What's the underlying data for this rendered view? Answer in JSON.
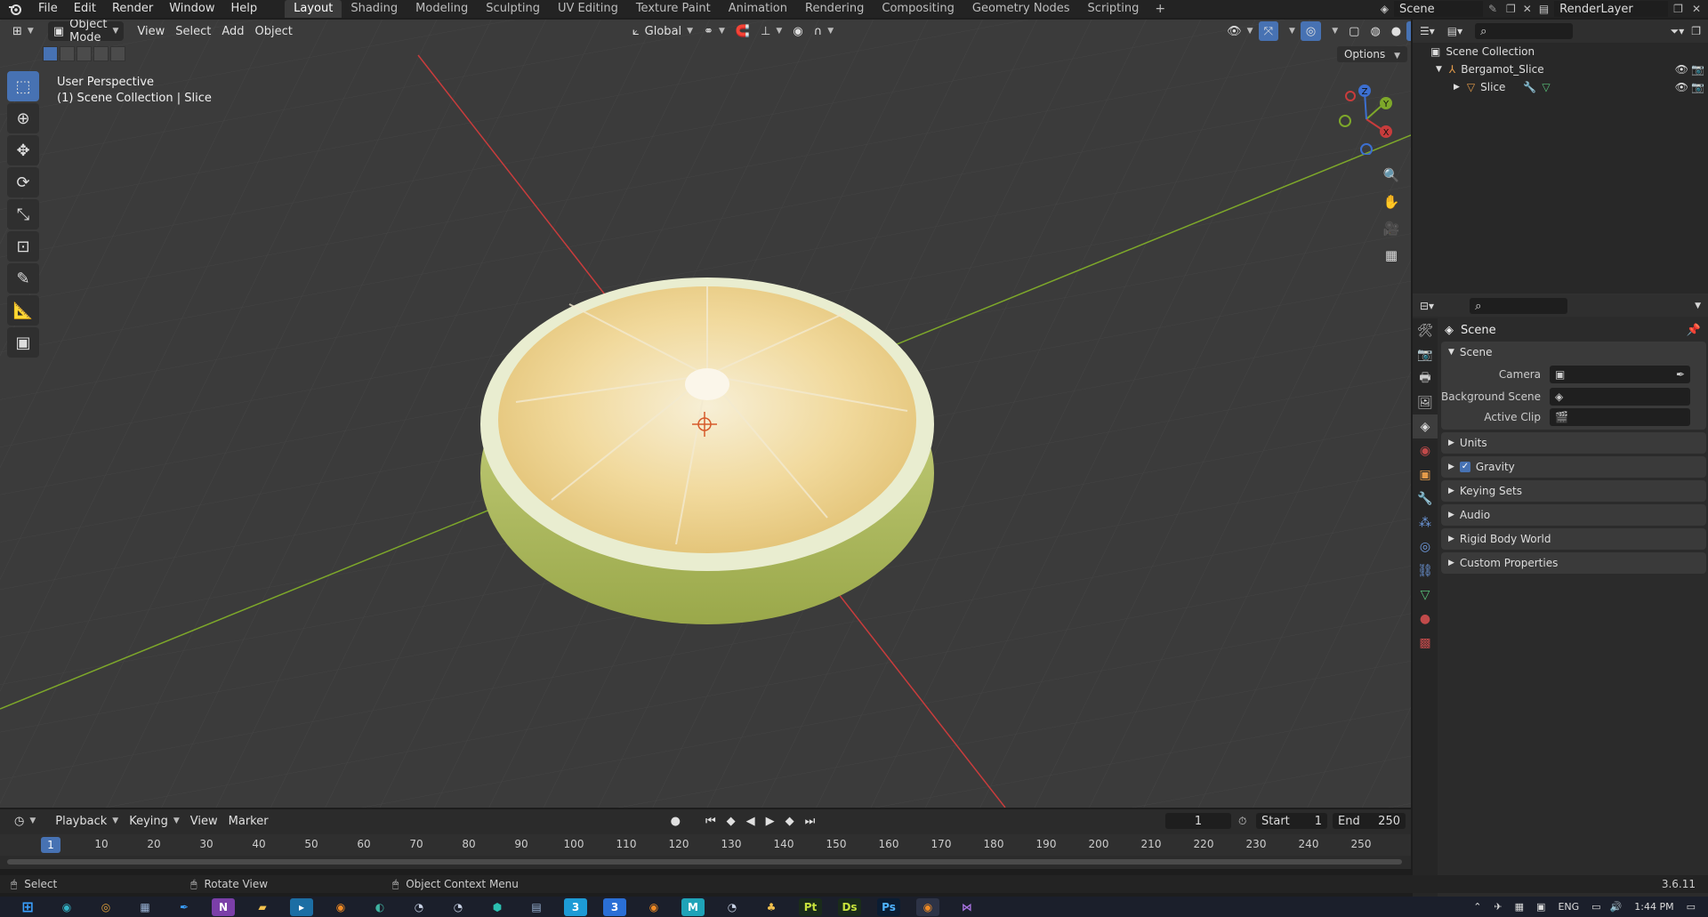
{
  "app": {
    "logo": "blender-logo-icon"
  },
  "menubar": {
    "items": [
      "File",
      "Edit",
      "Render",
      "Window",
      "Help"
    ]
  },
  "workspaces": {
    "tabs": [
      "Layout",
      "Shading",
      "Modeling",
      "Sculpting",
      "UV Editing",
      "Texture Paint",
      "Animation",
      "Rendering",
      "Compositing",
      "Geometry Nodes",
      "Scripting"
    ],
    "active": "Layout",
    "add": "+"
  },
  "topright": {
    "scene": "Scene",
    "view_layer": "RenderLayer"
  },
  "viewport_header": {
    "mode": "Object Mode",
    "menus": [
      "View",
      "Select",
      "Add",
      "Object"
    ],
    "transform_orientation": "Global"
  },
  "viewport": {
    "perspective": "User Perspective",
    "collection": "(1) Scene Collection | Slice",
    "options": "Options",
    "gizmo": {
      "x": "X",
      "y": "Y",
      "z": "Z"
    }
  },
  "outliner": {
    "root": "Scene Collection",
    "items": [
      {
        "name": "Bergamot_Slice"
      },
      {
        "name": "Slice"
      }
    ]
  },
  "properties": {
    "title": "Scene",
    "scene_panel": {
      "title": "Scene",
      "rows": [
        {
          "label": "Camera"
        },
        {
          "label": "Background Scene"
        },
        {
          "label": "Active Clip"
        }
      ]
    },
    "collapsed_panels": [
      "Units",
      "Gravity",
      "Keying Sets",
      "Audio",
      "Rigid Body World",
      "Custom Properties"
    ]
  },
  "timeline": {
    "menus": [
      "Playback",
      "Keying",
      "View",
      "Marker"
    ],
    "current_frame": "1",
    "start_label": "Start",
    "start": "1",
    "end_label": "End",
    "end": "250",
    "ticks": [
      "1",
      "10",
      "20",
      "30",
      "40",
      "50",
      "60",
      "70",
      "80",
      "90",
      "100",
      "110",
      "120",
      "130",
      "140",
      "150",
      "160",
      "170",
      "180",
      "190",
      "200",
      "210",
      "220",
      "230",
      "240",
      "250"
    ]
  },
  "statusbar": {
    "select": "Select",
    "rotate": "Rotate View",
    "context": "Object Context Menu",
    "version": "3.6.11"
  },
  "taskbar": {
    "time": "1:44 PM",
    "lang": "ENG"
  },
  "colors": {
    "accent": "#4772b3",
    "x_axis": "#c83c3c",
    "y_axis": "#7ea82a",
    "z_axis": "#3c6fd0"
  }
}
